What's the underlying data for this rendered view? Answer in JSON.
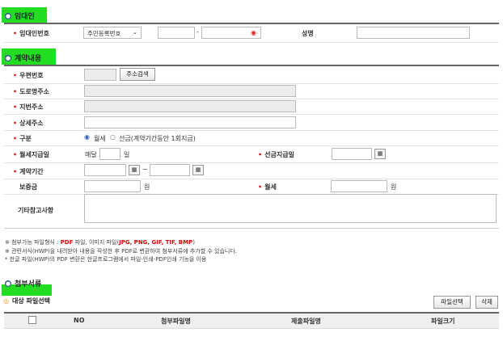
{
  "section1": {
    "title": "임대인"
  },
  "lessor": {
    "label": "임대인번호",
    "id_type": "주민등록번호",
    "dash": "-",
    "name_label": "성명"
  },
  "section2": {
    "title": "계약내용"
  },
  "contract": {
    "postal_label": "우편번호",
    "address_search": "주소검색",
    "road_label": "도로명주소",
    "lot_label": "지번주소",
    "detail_label": "상세주소",
    "type_label": "구분",
    "type_monthly": "월세",
    "type_advance": "선금(계약기간동안 1회지급)",
    "payday_label": "월세지급일",
    "payday_prefix": "매달",
    "payday_unit": "일",
    "advance_label": "선금지급일",
    "period_label": "계약기간",
    "period_sep": "~",
    "deposit_label": "보증금",
    "deposit_unit": "원",
    "rent_label": "월세",
    "rent_unit": "원",
    "etc_label": "기타참고사항"
  },
  "notes": {
    "line1_prefix": "※ 첨부가능 파일형식 : ",
    "line1_pdf": "PDF",
    "line1_mid": " 파일, 이미지 파일(",
    "line1_types": "JPG, PNG, GIF, TIF, BMP",
    "line1_end": ")",
    "line2": "※ 관련서식(HWP)을 내려받아 내용을 작성한 후 PDF로 변환하여 첨부서류에 추가할 수 있습니다.",
    "line3": "   * 한글 파일(HWP)의 PDF 변환은 한글프로그램에서 파일-인쇄-PDF인쇄 기능을 이용"
  },
  "section3": {
    "title": "첨부서류"
  },
  "attach": {
    "subtitle": "대상 파일선택",
    "select_button": "파일선택",
    "delete_button": "삭제",
    "columns": [
      "NO",
      "첨부파일명",
      "제출파일명",
      "파일크기"
    ]
  },
  "colors": {
    "highlight": "#22dd22",
    "required": "#dd2222",
    "accent": "#2d5a8c"
  }
}
